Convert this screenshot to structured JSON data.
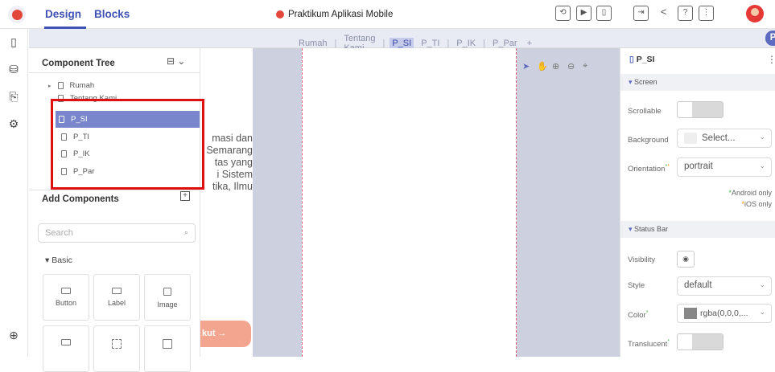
{
  "topbar": {
    "tabs": [
      "Design",
      "Blocks"
    ],
    "project_title": "Praktikum Aplikasi Mobile"
  },
  "screen_tabs": [
    "Rumah",
    "Tentang Kami",
    "P_SI",
    "P_TI",
    "P_IK",
    "P_Par",
    "+"
  ],
  "active_screen_tab": "P_SI",
  "public_label": "Public",
  "component_tree": {
    "title": "Component Tree",
    "items": [
      "Rumah",
      "Tentang Kami",
      "P_SI",
      "P_TI",
      "P_IK",
      "P_Par"
    ],
    "selected": "P_SI"
  },
  "add_components": {
    "title": "Add Components",
    "search_placeholder": "Search",
    "category": "Basic",
    "items": [
      "Button",
      "Label",
      "Image"
    ]
  },
  "background_page": {
    "lines": [
      "masi dan",
      "Semarang",
      "tas yang",
      "i Sistem",
      "tika, Ilmu"
    ],
    "button_label": "kut →"
  },
  "right_panel": {
    "title": "P_SI",
    "screen_section": "Screen",
    "scrollable_label": "Scrollable",
    "background_label": "Background",
    "background_value": "Select...",
    "orientation_label": "Orientation",
    "orientation_value": "portrait",
    "android_only": "Android only",
    "ios_only": "iOS only",
    "status_bar_section": "Status Bar",
    "visibility_label": "Visibility",
    "style_label": "Style",
    "style_value": "default",
    "color_label": "Color",
    "color_value": "rgba(0,0,0,...",
    "translucent_label": "Translucent"
  },
  "colors": {
    "accent": "#3f51b5",
    "selected_row": "#7986cb",
    "highlight_box": "#e01010",
    "canvas_bg": "#cdd0de"
  }
}
